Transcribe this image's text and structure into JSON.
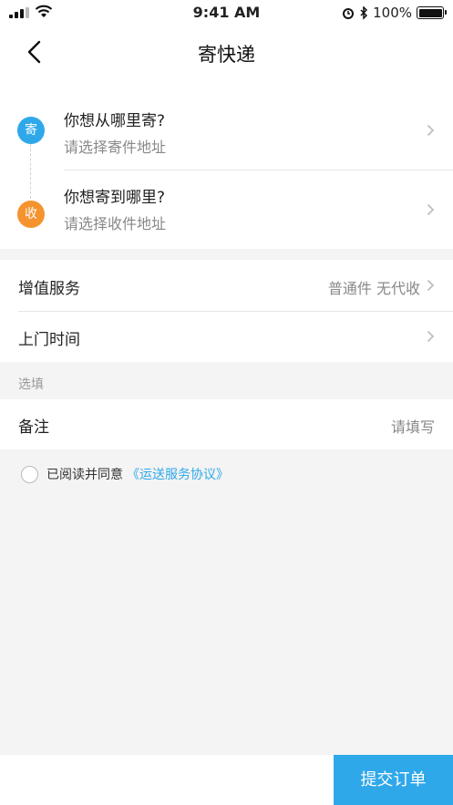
{
  "status_bar": {
    "time": "9:41 AM",
    "battery": "100%"
  },
  "nav": {
    "title": "寄快递"
  },
  "sender": {
    "badge": "寄",
    "title": "你想从哪里寄?",
    "placeholder": "请选择寄件地址"
  },
  "receiver": {
    "badge": "收",
    "title": "你想寄到哪里?",
    "placeholder": "请选择收件地址"
  },
  "services": {
    "label": "增值服务",
    "value": "普通件 无代收"
  },
  "pickup_time": {
    "label": "上门时间"
  },
  "optional_section": {
    "label": "选填"
  },
  "remark": {
    "label": "备注",
    "placeholder": "请填写"
  },
  "agreement": {
    "text": "已阅读并同意",
    "link": "《运送服务协议》"
  },
  "submit": {
    "label": "提交订单"
  },
  "colors": {
    "accent": "#2fa8ea",
    "sender_badge": "#2fa8ea",
    "receiver_badge": "#f5932f"
  }
}
